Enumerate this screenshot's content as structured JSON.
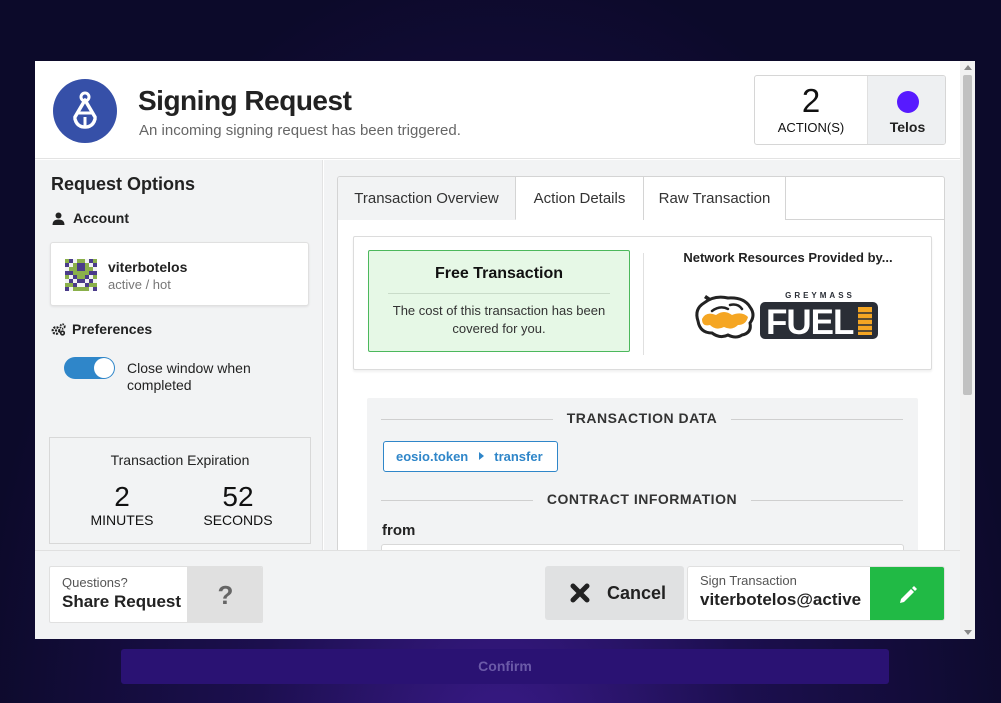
{
  "header": {
    "title": "Signing Request",
    "subtitle": "An incoming signing request has been triggered.",
    "actions_count": "2",
    "actions_label": "ACTION(S)",
    "chain_name": "Telos",
    "chain_color": "#571aff"
  },
  "sidebar": {
    "title": "Request Options",
    "account_label": "Account",
    "account_name": "viterbotelos",
    "account_permission": "active / hot",
    "preferences_label": "Preferences",
    "toggle_label": "Close window when completed",
    "toggle_on": true,
    "expiration": {
      "title": "Transaction Expiration",
      "minutes_value": "2",
      "minutes_label": "MINUTES",
      "seconds_value": "52",
      "seconds_label": "SECONDS"
    }
  },
  "tabs": [
    {
      "label": "Transaction Overview",
      "active": true
    },
    {
      "label": "Action Details",
      "active": false
    },
    {
      "label": "Raw Transaction",
      "active": false
    }
  ],
  "fee": {
    "title": "Free Transaction",
    "description": "The cost of this transaction has been covered for you.",
    "network_title": "Network Resources Provided by...",
    "provider_small": "GREYMASS",
    "provider_big": "FUEL"
  },
  "transaction": {
    "section_title": "TRANSACTION DATA",
    "contract": "eosio.token",
    "action": "transfer",
    "contract_section_title": "CONTRACT INFORMATION",
    "field_from_label": "from"
  },
  "footer": {
    "questions_label": "Questions?",
    "share_label": "Share Request",
    "help_symbol": "?",
    "cancel_label": "Cancel",
    "sign_small": "Sign Transaction",
    "sign_account": "viterbotelos@active"
  },
  "confirm_label": "Confirm",
  "colors": {
    "brand_blue": "#3650a8",
    "accent_blue": "#2f86c9",
    "success_green": "#21ba45",
    "free_bg": "#e6f8e6"
  }
}
